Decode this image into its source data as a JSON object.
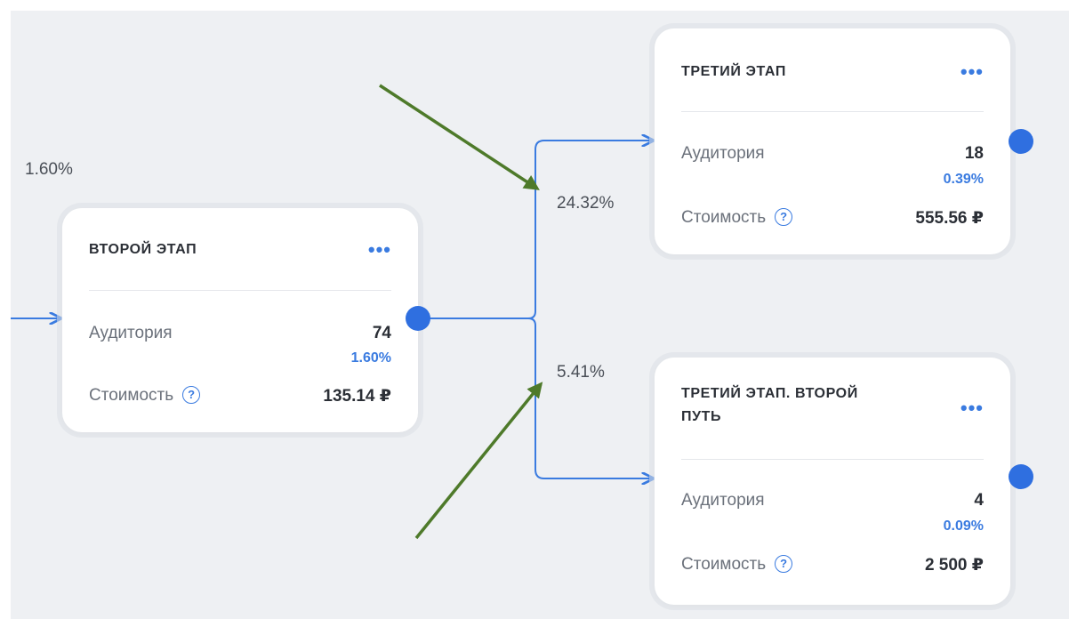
{
  "labels": {
    "left_percent": "1.60%",
    "upper_branch_percent": "24.32%",
    "lower_branch_percent": "5.41%"
  },
  "cards": {
    "second": {
      "title": "ВТОРОЙ ЭТАП",
      "menu": "•••",
      "audience_label": "Аудитория",
      "audience_value": "74",
      "audience_percent": "1.60%",
      "cost_label": "Стоимость",
      "cost_value": "135.14 ₽",
      "help_icon": "?"
    },
    "third": {
      "title": "ТРЕТИЙ ЭТАП",
      "menu": "•••",
      "audience_label": "Аудитория",
      "audience_value": "18",
      "audience_percent": "0.39%",
      "cost_label": "Стоимость",
      "cost_value": "555.56 ₽",
      "help_icon": "?"
    },
    "third_alt": {
      "title_line1": "ТРЕТИЙ ЭТАП. ВТОРОЙ",
      "title_line2": "ПУТЬ",
      "menu": "•••",
      "audience_label": "Аудитория",
      "audience_value": "4",
      "audience_percent": "0.09%",
      "cost_label": "Стоимость",
      "cost_value": "2 500 ₽",
      "help_icon": "?"
    }
  },
  "colors": {
    "accent": "#3a7be0",
    "connector": "#3a7be0",
    "annotation_arrow": "#4e7a2a",
    "canvas": "#eef0f3"
  }
}
